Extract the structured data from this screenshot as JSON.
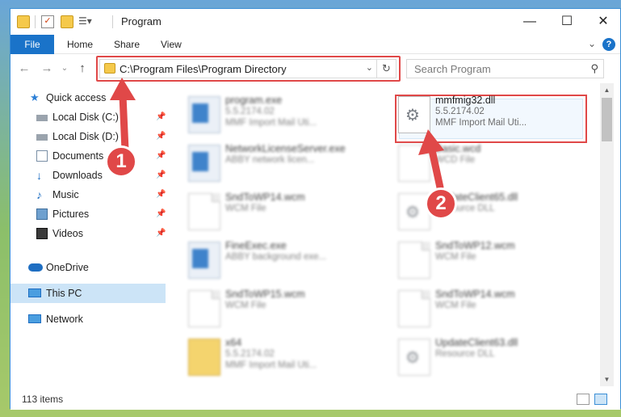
{
  "window": {
    "title": "Program"
  },
  "ribbon": {
    "tabs": [
      "File",
      "Home",
      "Share",
      "View"
    ],
    "help": "?"
  },
  "nav": {
    "address": "C:\\Program Files\\Program Directory",
    "search_placeholder": "Search Program"
  },
  "sidebar": {
    "items": [
      {
        "label": "Quick access",
        "icon": "star-icon"
      },
      {
        "label": "Local Disk (C:)",
        "icon": "drive-icon",
        "pinned": true
      },
      {
        "label": "Local Disk (D:)",
        "icon": "drive-icon",
        "pinned": true
      },
      {
        "label": "Documents",
        "icon": "documents-icon",
        "pinned": true
      },
      {
        "label": "Downloads",
        "icon": "downloads-icon",
        "pinned": true
      },
      {
        "label": "Music",
        "icon": "music-icon",
        "pinned": true
      },
      {
        "label": "Pictures",
        "icon": "pictures-icon",
        "pinned": true
      },
      {
        "label": "Videos",
        "icon": "videos-icon",
        "pinned": true
      },
      {
        "label": "OneDrive",
        "icon": "cloud-icon"
      },
      {
        "label": "This PC",
        "icon": "pc-icon",
        "selected": true
      },
      {
        "label": "Network",
        "icon": "network-icon"
      }
    ]
  },
  "files": [
    {
      "name": "program.exe",
      "line2": "5.5.2174.02",
      "line3": "MMF Import Mail Uti...",
      "icon": "program-exe-icon"
    },
    {
      "name": "mmfmig32.dll",
      "line2": "5.5.2174.02",
      "line3": "MMF Import Mail Uti...",
      "icon": "dll-gear-icon",
      "selected": true
    },
    {
      "name": "NetworkLicenseServer.exe",
      "line2": "ABBY network licen...",
      "line3": "",
      "icon": "exe-icon"
    },
    {
      "name": "Basic.wcd",
      "line2": "WCD File",
      "line3": "",
      "icon": "document-icon"
    },
    {
      "name": "SndToWP14.wcm",
      "line2": "WCM File",
      "line3": "",
      "icon": "document-icon"
    },
    {
      "name": "UpdateClient65.dll",
      "line2": "Resource DLL",
      "line3": "",
      "icon": "dll-gear-icon"
    },
    {
      "name": "FineExec.exe",
      "line2": "ABBY background exe...",
      "line3": "",
      "icon": "exe-icon"
    },
    {
      "name": "SndToWP12.wcm",
      "line2": "WCM File",
      "line3": "",
      "icon": "document-icon"
    },
    {
      "name": "SndToWP15.wcm",
      "line2": "WCM File",
      "line3": "",
      "icon": "document-icon"
    },
    {
      "name": "SndToWP14.wcm",
      "line2": "WCM File",
      "line3": "",
      "icon": "document-icon"
    },
    {
      "name": "x64",
      "line2": "5.5.2174.02",
      "line3": "MMF Import Mail Uti...",
      "icon": "folder-icon"
    },
    {
      "name": "UpdateClient63.dll",
      "line2": "Resource DLL",
      "line3": "",
      "icon": "dll-gear-icon"
    }
  ],
  "status": {
    "items_count": "113 items"
  },
  "annotations": {
    "step1": "1",
    "step2": "2",
    "color": "#e04848"
  }
}
